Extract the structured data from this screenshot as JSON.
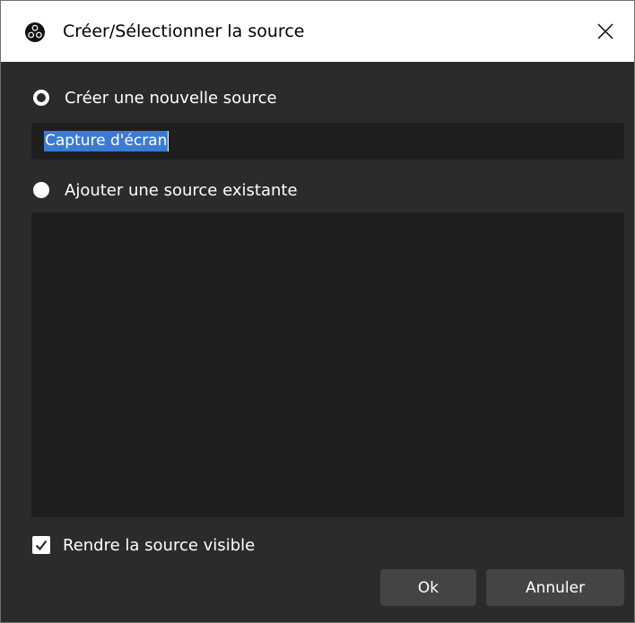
{
  "window": {
    "title": "Créer/Sélectionner la source",
    "icon": "obs-logo-icon",
    "close_icon": "close-icon"
  },
  "create_option": {
    "label": "Créer une nouvelle source",
    "selected": true
  },
  "name_input": {
    "value": "Capture d'écran"
  },
  "existing_option": {
    "label": "Ajouter une source existante",
    "selected": false
  },
  "existing_sources": [],
  "visible_checkbox": {
    "label": "Rendre la source visible",
    "checked": true
  },
  "buttons": {
    "ok_label": "Ok",
    "cancel_label": "Annuler"
  },
  "colors": {
    "background": "#2b2b2b",
    "field": "#1e1e1e",
    "button": "#444444",
    "selection": "#3a7bd5",
    "titlebar": "#ffffff"
  }
}
